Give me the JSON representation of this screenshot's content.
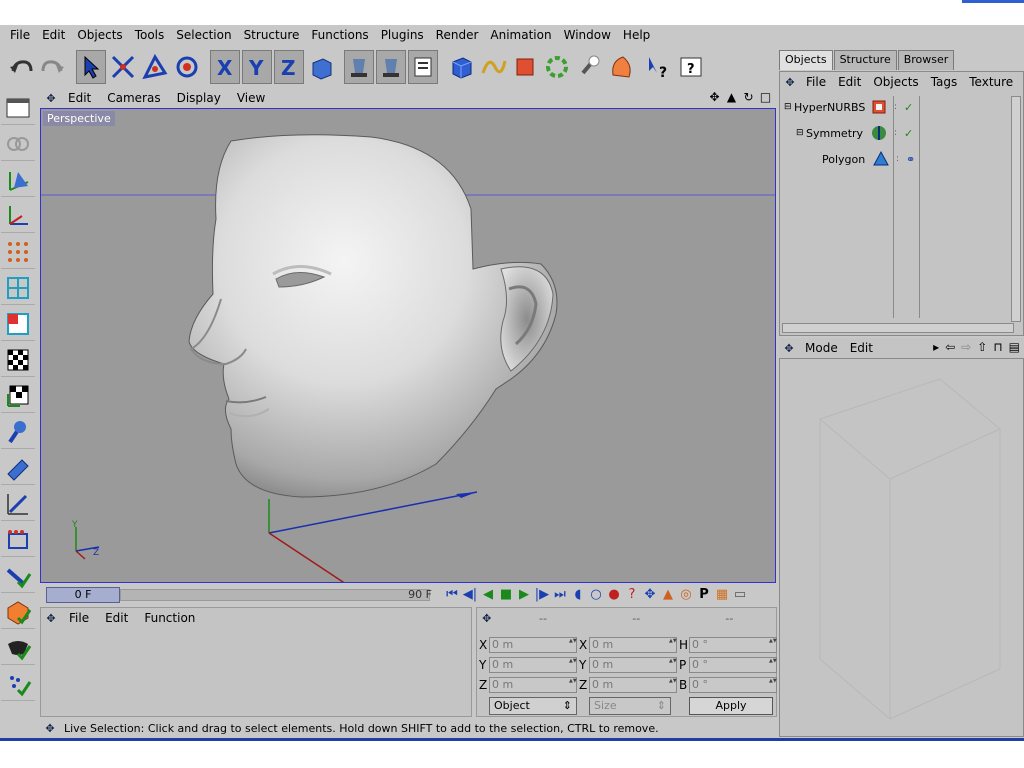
{
  "menubar": {
    "items": [
      "File",
      "Edit",
      "Objects",
      "Tools",
      "Selection",
      "Structure",
      "Functions",
      "Plugins",
      "Render",
      "Animation",
      "Window",
      "Help"
    ]
  },
  "toolbar": {
    "icons": [
      "undo-icon",
      "redo-icon",
      "live-selection-icon",
      "move-icon",
      "scale-icon",
      "rotate-icon",
      "x-axis-lock-icon",
      "y-axis-lock-icon",
      "z-axis-lock-icon",
      "coordinate-system-icon",
      "render-view-icon",
      "render-region-icon",
      "render-settings-icon",
      "cube-primitive-icon",
      "spline-icon",
      "nurbs-icon",
      "deformer-icon",
      "light-icon",
      "material-icon",
      "context-help-icon",
      "info-icon"
    ]
  },
  "palette": {
    "icons": [
      "layout-icon",
      "cameras-icon",
      "model-axis-icon",
      "object-axis-icon",
      "points-mode-icon",
      "edges-mode-icon",
      "polygons-mode-icon",
      "texture-mode-icon",
      "texture-axis-icon",
      "knife-icon",
      "magnet-icon",
      "brush-icon",
      "array-icon",
      "enable-axis-icon",
      "enable-snap-icon",
      "solo-icon",
      "paint-icon"
    ]
  },
  "viewport": {
    "menu": [
      "Edit",
      "Cameras",
      "Display",
      "View"
    ],
    "label": "Perspective",
    "axis_labels": {
      "y": "Y",
      "z": "Z"
    },
    "navicons": [
      "move-view-icon",
      "zoom-view-icon",
      "rotate-view-icon",
      "maximize-view-icon"
    ]
  },
  "timeline": {
    "current": "0 F",
    "end": "90 F"
  },
  "bottom_panel": {
    "menu": [
      "File",
      "Edit",
      "Function"
    ]
  },
  "coordinates": {
    "headers": [
      "--",
      "--",
      "--"
    ],
    "rows": [
      {
        "c1": "X",
        "v1": "0 m",
        "c2": "X",
        "v2": "0 m",
        "c3": "H",
        "v3": "0 °"
      },
      {
        "c1": "Y",
        "v1": "0 m",
        "c2": "Y",
        "v2": "0 m",
        "c3": "P",
        "v3": "0 °"
      },
      {
        "c1": "Z",
        "v1": "0 m",
        "c2": "Z",
        "v2": "0 m",
        "c3": "B",
        "v3": "0 °"
      }
    ],
    "mode": "Object",
    "size": "Size",
    "apply": "Apply"
  },
  "right_panel": {
    "tabs": [
      "Objects",
      "Structure",
      "Browser"
    ],
    "menu": [
      "File",
      "Edit",
      "Objects",
      "Tags",
      "Texture"
    ],
    "objects": [
      {
        "name": "HyperNURBS"
      },
      {
        "name": "Symmetry"
      },
      {
        "name": "Polygon"
      }
    ]
  },
  "attributes": {
    "menu": [
      "Mode",
      "Edit"
    ]
  },
  "status": {
    "text": "Live Selection: Click and drag to select elements. Hold down SHIFT to add to the selection, CTRL to remove."
  }
}
